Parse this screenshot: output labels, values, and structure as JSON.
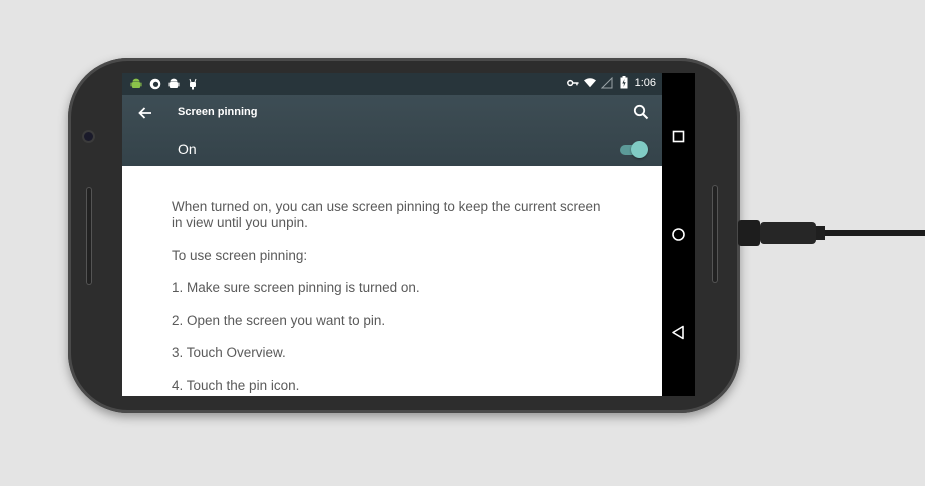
{
  "status_bar": {
    "left_icons": [
      "android-icon",
      "firefox-icon",
      "android-icon",
      "robot-icon"
    ],
    "right_icons": [
      "vpn-key-icon",
      "wifi-icon",
      "signal-icon",
      "battery-charging-icon"
    ],
    "time": "1:06"
  },
  "toolbar": {
    "title": "Screen pinning",
    "back_icon": "arrow-back-icon",
    "search_icon": "search-icon"
  },
  "master_switch": {
    "label": "On",
    "checked": true,
    "accent": "#80cbc4"
  },
  "content": {
    "paragraphs": [
      "When turned on, you can use screen pinning to keep the current screen in view until you unpin.",
      "To use screen pinning:",
      "1. Make sure screen pinning is turned on.",
      "2. Open the screen you want to pin.",
      "3. Touch Overview.",
      "4. Touch the pin icon."
    ]
  },
  "nav_bar": {
    "buttons": [
      "recents-icon",
      "home-icon",
      "back-triangle-icon"
    ]
  },
  "colors": {
    "toolbar": "#3a4950",
    "status_bar": "#28353b",
    "body_text": "#5a5a5a"
  }
}
